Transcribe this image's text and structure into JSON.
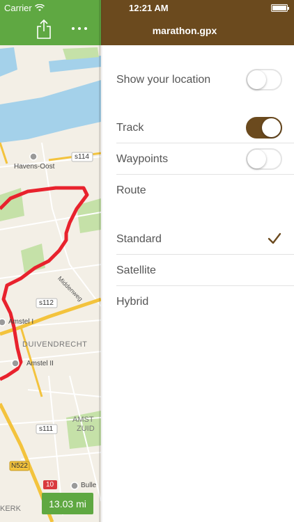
{
  "status_bar": {
    "carrier": "Carrier",
    "time": "12:21 AM"
  },
  "map": {
    "labels": {
      "havens_oost": "Havens-Oost",
      "s114": "s114",
      "s112": "s112",
      "s111": "s111",
      "middenweg": "Middenweg",
      "amstel_i": "Amstel I",
      "amstel_ii": "Amstel II",
      "duivendrecht": "DUIVENDRECHT",
      "amst": "AMST",
      "zuid": "ZUID",
      "n522": "N522",
      "a10": "10",
      "bulle": "Bulle",
      "kerk": "KERK"
    },
    "distance": "13.03 mi",
    "colors": {
      "header": "#5fa842",
      "track": "#e8222d",
      "water": "#a4d1ea",
      "park": "#c5e1a8",
      "highway": "#f3c33d"
    },
    "icons": {
      "share": "share-icon",
      "more": "more-icon"
    }
  },
  "panel": {
    "title": "marathon.gpx",
    "accent": "#6b4a1e",
    "show_location": {
      "label": "Show your location",
      "on": false
    },
    "track": {
      "label": "Track",
      "on": true
    },
    "waypoints": {
      "label": "Waypoints",
      "on": false
    },
    "route": {
      "label": "Route"
    },
    "map_types": [
      {
        "label": "Standard",
        "selected": true
      },
      {
        "label": "Satellite",
        "selected": false
      },
      {
        "label": "Hybrid",
        "selected": false
      }
    ]
  }
}
